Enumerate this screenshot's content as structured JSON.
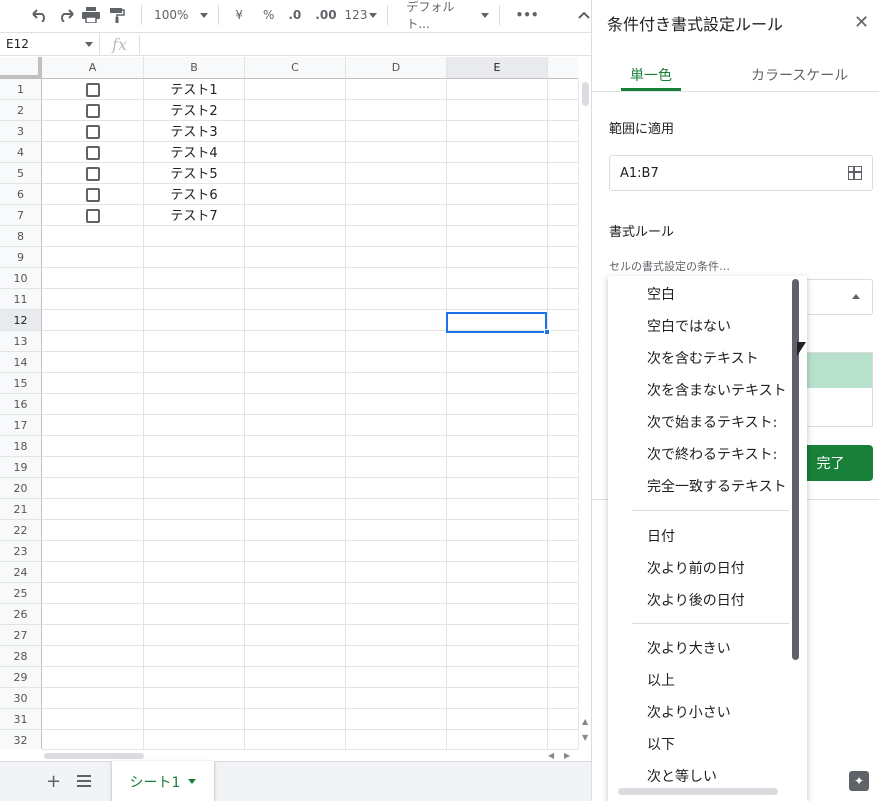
{
  "toolbar": {
    "zoom": "100%",
    "currency": "¥",
    "percent": "%",
    "decrease_decimal": ".0",
    "increase_decimal": ".00",
    "format_more": "123",
    "font": "デフォルト...",
    "more": "•••"
  },
  "formula_bar": {
    "cell_ref": "E12",
    "fx": "fx"
  },
  "grid": {
    "columns": [
      "A",
      "B",
      "C",
      "D",
      "E"
    ],
    "rows": [
      "1",
      "2",
      "3",
      "4",
      "5",
      "6",
      "7",
      "8",
      "9",
      "10",
      "11",
      "12",
      "13",
      "14",
      "15",
      "16",
      "17",
      "18",
      "19",
      "20",
      "21",
      "22",
      "23",
      "24",
      "25",
      "26",
      "27",
      "28",
      "29",
      "30",
      "31",
      "32"
    ],
    "selected_cell": "E12",
    "column_b": [
      "テスト1",
      "テスト2",
      "テスト3",
      "テスト4",
      "テスト5",
      "テスト6",
      "テスト7"
    ]
  },
  "sheets": {
    "active": "シート1"
  },
  "panel": {
    "title": "条件付き書式設定ルール",
    "tabs": [
      "単一色",
      "カラースケール"
    ],
    "range_label": "範囲に適用",
    "range_value": "A1:B7",
    "rules_label": "書式ルール",
    "condition_label": "セルの書式設定の条件…",
    "done": "完了",
    "preview_fill": "#b7e1cd"
  },
  "dropdown": {
    "group1": [
      "空白",
      "空白ではない",
      "次を含むテキスト",
      "次を含まないテキスト",
      "次で始まるテキスト:",
      "次で終わるテキスト:",
      "完全一致するテキスト"
    ],
    "group2": [
      "日付",
      "次より前の日付",
      "次より後の日付"
    ],
    "group3": [
      "次より大きい",
      "以上",
      "次より小さい",
      "以下",
      "次と等しい"
    ]
  },
  "colors": {
    "accent": "#188038",
    "selection": "#1a73e8"
  }
}
